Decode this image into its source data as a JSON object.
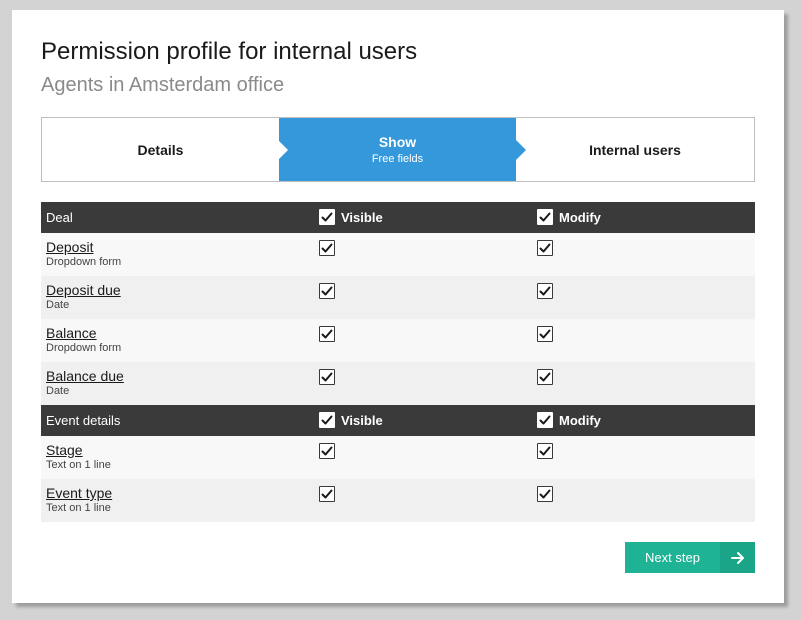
{
  "page": {
    "title": "Permission profile for internal users",
    "subtitle": "Agents in Amsterdam office"
  },
  "stepper": {
    "steps": [
      {
        "label": "Details",
        "sub": ""
      },
      {
        "label": "Show",
        "sub": "Free fields",
        "active": true
      },
      {
        "label": "Internal users",
        "sub": ""
      }
    ]
  },
  "table": {
    "sections": [
      {
        "name": "Deal",
        "visible_label": "Visible",
        "modify_label": "Modify",
        "visible_checked": true,
        "modify_checked": true,
        "rows": [
          {
            "name": "Deposit",
            "type": "Dropdown form",
            "visible": true,
            "modify": true
          },
          {
            "name": "Deposit due",
            "type": "Date",
            "visible": true,
            "modify": true
          },
          {
            "name": "Balance",
            "type": "Dropdown form",
            "visible": true,
            "modify": true
          },
          {
            "name": "Balance due",
            "type": "Date",
            "visible": true,
            "modify": true
          }
        ]
      },
      {
        "name": "Event details",
        "visible_label": "Visible",
        "modify_label": "Modify",
        "visible_checked": true,
        "modify_checked": true,
        "rows": [
          {
            "name": "Stage",
            "type": "Text on 1 line",
            "visible": true,
            "modify": true
          },
          {
            "name": "Event type",
            "type": "Text on 1 line",
            "visible": true,
            "modify": true
          }
        ]
      }
    ]
  },
  "actions": {
    "next_label": "Next step",
    "next_icon": "arrow-right-icon"
  },
  "colors": {
    "accent": "#3498db",
    "header_bg": "#3a3a3a",
    "next_bg": "#1fb395"
  }
}
